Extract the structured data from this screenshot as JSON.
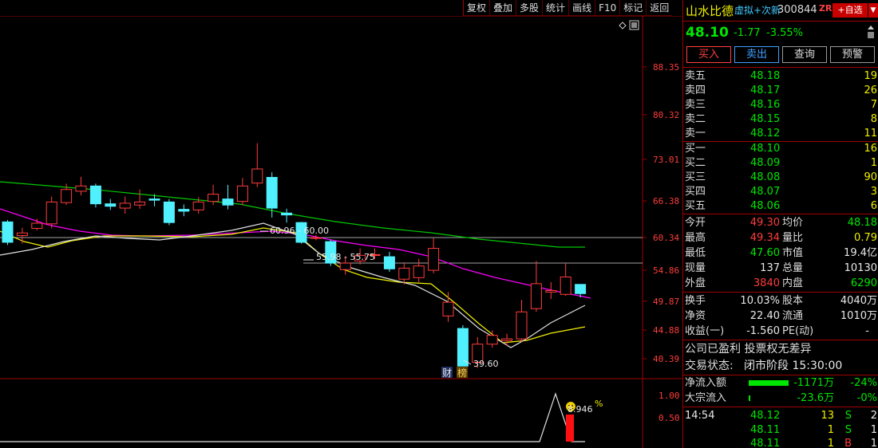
{
  "toolbar": {
    "items": [
      "复权",
      "叠加",
      "多股",
      "统计",
      "画线",
      "F10",
      "标记",
      "返回"
    ]
  },
  "chart": {
    "price_labels": [
      "88.35",
      "80.32",
      "73.01",
      "66.38",
      "60.34",
      "54.86",
      "49.87",
      "44.88",
      "40.39"
    ],
    "indicator_labels": [
      "1.00",
      "0.50"
    ],
    "annotations": {
      "a1": "60.96 - 60.00",
      "a2": "55.98 - 55.75",
      "a3": "39.60",
      "tag_cai": "财",
      "tag_bang": "榜",
      "pct": "8.946",
      "pct_unit": "%"
    },
    "candles": [
      {
        "o": 58.3,
        "c": 55.2,
        "h": 58.6,
        "l": 54.8
      },
      {
        "o": 56.2,
        "c": 56.6,
        "h": 57.4,
        "l": 55.0
      },
      {
        "o": 57.3,
        "c": 58.1,
        "h": 58.8,
        "l": 57.0
      },
      {
        "o": 58.0,
        "c": 61.5,
        "h": 62.4,
        "l": 57.3
      },
      {
        "o": 61.4,
        "c": 63.6,
        "h": 64.6,
        "l": 61.0
      },
      {
        "o": 63.3,
        "c": 64.2,
        "h": 65.8,
        "l": 62.6
      },
      {
        "o": 64.2,
        "c": 61.2,
        "h": 64.6,
        "l": 60.6
      },
      {
        "o": 61.2,
        "c": 60.8,
        "h": 62.0,
        "l": 60.2
      },
      {
        "o": 60.5,
        "c": 61.3,
        "h": 62.4,
        "l": 59.6
      },
      {
        "o": 61.0,
        "c": 61.5,
        "h": 63.6,
        "l": 60.4
      },
      {
        "o": 62.0,
        "c": 61.8,
        "h": 62.8,
        "l": 60.8
      },
      {
        "o": 61.5,
        "c": 58.2,
        "h": 62.0,
        "l": 57.8
      },
      {
        "o": 60.3,
        "c": 60.0,
        "h": 61.1,
        "l": 59.2
      },
      {
        "o": 60.2,
        "c": 61.5,
        "h": 62.3,
        "l": 59.6
      },
      {
        "o": 61.6,
        "c": 62.8,
        "h": 64.4,
        "l": 61.0
      },
      {
        "o": 62.0,
        "c": 61.0,
        "h": 64.4,
        "l": 60.3
      },
      {
        "o": 61.6,
        "c": 64.2,
        "h": 65.6,
        "l": 61.0
      },
      {
        "o": 64.7,
        "c": 67.2,
        "h": 72.0,
        "l": 64.0
      },
      {
        "o": 65.7,
        "c": 60.5,
        "h": 66.6,
        "l": 59.0
      },
      {
        "o": 59.7,
        "c": 59.4,
        "h": 60.4,
        "l": 58.2
      },
      {
        "o": 58.2,
        "c": 55.2,
        "h": 58.3,
        "l": 55.0
      },
      {
        "o": 55.8,
        "c": 55.9,
        "h": 56.3,
        "l": 55.5
      },
      {
        "o": 55.3,
        "c": 52.2,
        "h": 55.6,
        "l": 51.8
      },
      {
        "o": 51.3,
        "c": 52.2,
        "h": 53.2,
        "l": 50.6
      },
      {
        "o": 52.5,
        "c": 53.3,
        "h": 54.3,
        "l": 52.0
      },
      {
        "o": 53.3,
        "c": 53.4,
        "h": 54.3,
        "l": 52.8
      },
      {
        "o": 53.1,
        "c": 51.4,
        "h": 53.8,
        "l": 51.0
      },
      {
        "o": 50.0,
        "c": 51.5,
        "h": 52.3,
        "l": 49.3
      },
      {
        "o": 50.2,
        "c": 51.8,
        "h": 52.8,
        "l": 49.6
      },
      {
        "o": 51.2,
        "c": 54.3,
        "h": 55.8,
        "l": 50.8
      },
      {
        "o": 45.3,
        "c": 47.0,
        "h": 48.3,
        "l": 44.6
      },
      {
        "o": 43.8,
        "c": 39.6,
        "h": 44.2,
        "l": 39.6
      },
      {
        "o": 40.0,
        "c": 42.0,
        "h": 42.8,
        "l": 39.4
      },
      {
        "o": 42.0,
        "c": 43.0,
        "h": 43.6,
        "l": 41.6
      },
      {
        "o": 42.4,
        "c": 42.6,
        "h": 43.2,
        "l": 41.8
      },
      {
        "o": 42.6,
        "c": 45.8,
        "h": 47.3,
        "l": 42.2
      },
      {
        "o": 46.2,
        "c": 49.4,
        "h": 52.5,
        "l": 45.8
      },
      {
        "o": 48.3,
        "c": 48.5,
        "h": 49.6,
        "l": 47.4
      },
      {
        "o": 48.0,
        "c": 50.3,
        "h": 52.2,
        "l": 47.8
      },
      {
        "o": 49.3,
        "c": 48.1,
        "h": 49.3,
        "l": 47.6
      }
    ]
  },
  "panel": {
    "name": "山水比德",
    "tag": "虚拟+次新",
    "code": "300844",
    "zr": "ZR",
    "fav_label": "+自选",
    "drop": "▼",
    "price": "48.10",
    "change": "-1.77",
    "change_pct": "-3.55%",
    "buttons": {
      "buy": "买入",
      "sell": "卖出",
      "query": "查询",
      "warn": "预警"
    },
    "asks": [
      {
        "label": "卖五",
        "price": "48.18",
        "vol": "19"
      },
      {
        "label": "卖四",
        "price": "48.17",
        "vol": "26"
      },
      {
        "label": "卖三",
        "price": "48.16",
        "vol": "7"
      },
      {
        "label": "卖二",
        "price": "48.15",
        "vol": "8"
      },
      {
        "label": "卖一",
        "price": "48.12",
        "vol": "11"
      }
    ],
    "bids": [
      {
        "label": "买一",
        "price": "48.10",
        "vol": "16"
      },
      {
        "label": "买二",
        "price": "48.09",
        "vol": "1"
      },
      {
        "label": "买三",
        "price": "48.08",
        "vol": "90"
      },
      {
        "label": "买四",
        "price": "48.07",
        "vol": "3"
      },
      {
        "label": "买五",
        "price": "48.06",
        "vol": "6"
      }
    ],
    "stats": [
      {
        "l1": "今开",
        "v1": "49.30",
        "c1": "red",
        "l2": "均价",
        "v2": "48.18",
        "c2": "green"
      },
      {
        "l1": "最高",
        "v1": "49.34",
        "c1": "red",
        "l2": "量比",
        "v2": "0.79",
        "c2": "yellow"
      },
      {
        "l1": "最低",
        "v1": "47.60",
        "c1": "green",
        "l2": "市值",
        "v2": "19.4亿",
        "c2": "white"
      },
      {
        "l1": "现量",
        "v1": "137",
        "c1": "white",
        "l2": "总量",
        "v2": "10130",
        "c2": "white"
      },
      {
        "l1": "外盘",
        "v1": "3840",
        "c1": "red",
        "l2": "内盘",
        "v2": "6290",
        "c2": "green"
      }
    ],
    "stats2": [
      {
        "l1": "换手",
        "v1": "10.03%",
        "c1": "white",
        "l2": "股本",
        "v2": "4040万",
        "c2": "white"
      },
      {
        "l1": "净资",
        "v1": "22.40",
        "c1": "white",
        "l2": "流通",
        "v2": "1010万",
        "c2": "white"
      },
      {
        "l1": "收益(一)",
        "v1": "-1.560",
        "c1": "white",
        "l2": "PE(动)",
        "v2": "-",
        "c2": "white"
      }
    ],
    "info1": "公司已盈利 投票权无差异",
    "status_label": "交易状态:",
    "status_val": "闭市阶段 15:30:00",
    "flow1_label": "净流入额",
    "flow1_val": "-1171万",
    "flow1_pct": "-24%",
    "flow2_label": "大宗流入",
    "flow2_val": "-23.6万",
    "flow2_pct": "-0%",
    "ticks": [
      {
        "time": "14:54",
        "price": "48.12",
        "vol": "13",
        "side": "S",
        "n": "2"
      },
      {
        "time": "",
        "price": "48.11",
        "vol": "1",
        "side": "S",
        "n": "1"
      },
      {
        "time": "",
        "price": "48.11",
        "vol": "1",
        "side": "B",
        "n": "1"
      }
    ],
    "colors": {
      "up": "#ff3c3c",
      "down": "#00e600",
      "border": "#a00000"
    }
  }
}
